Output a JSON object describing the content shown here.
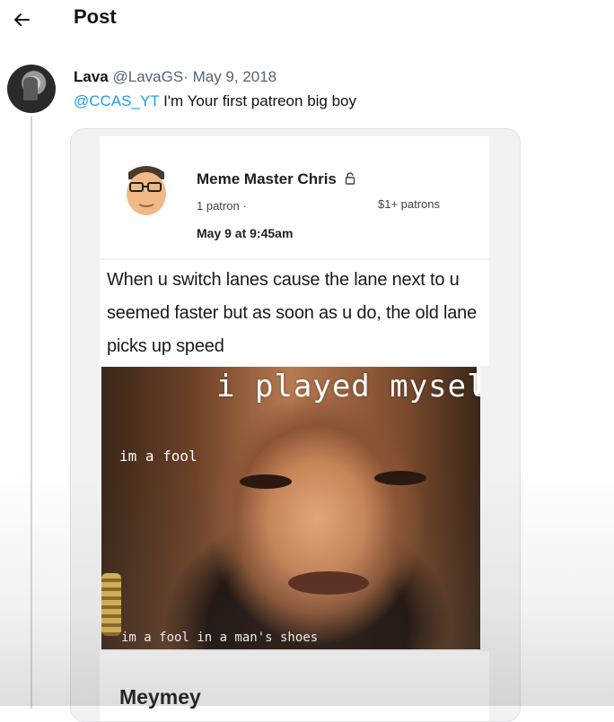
{
  "header": {
    "back_icon": "arrow-left-icon",
    "title": "Post"
  },
  "tweet": {
    "author_name": "Lava",
    "author_handle": "@LavaGS",
    "separator": "·",
    "date": "May 9, 2018",
    "mention": "@CCAS_YT",
    "text": " I'm Your first patreon big boy"
  },
  "embed": {
    "creator_name": "Meme Master Chris",
    "lock_icon": "lock-icon",
    "patron_count": "1 patron ·",
    "tier": "$1+ patrons",
    "post_date": "May 9 at 9:45am",
    "caption": "When u switch lanes cause the lane next to u seemed faster but as soon as u do, the old lane picks up speed",
    "meme": {
      "top_text": "i played myself",
      "middle_text": "im a fool",
      "bottom_text": "im a fool in a man's shoes"
    },
    "footer_title": "Meymey"
  },
  "colors": {
    "mention": "#1d9bf0",
    "secondary_text": "#536471",
    "thread_line": "#cfd9de"
  }
}
